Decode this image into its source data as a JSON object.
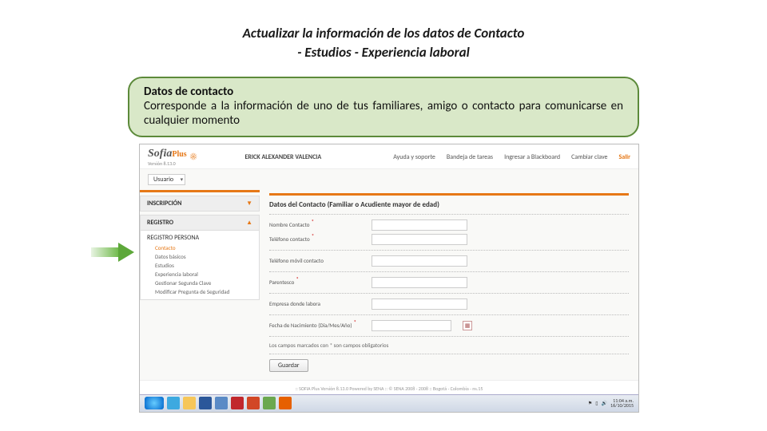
{
  "slide": {
    "title_line1": "Actualizar la información de los datos de Contacto",
    "title_line2": "- Estudios - Experiencia laboral"
  },
  "infobox": {
    "heading": "Datos de contacto",
    "body": "Corresponde a la información de uno de tus familiares, amigo o contacto para comunicarse en cualquier momento"
  },
  "logo": {
    "brand": "Sofia",
    "suffix": "Plus",
    "version": "Versión 8.13.0"
  },
  "topbar": {
    "user": "ERICK ALEXANDER VALENCIA",
    "links": {
      "help": "Ayuda y soporte",
      "tasks": "Bandeja de tareas",
      "blackboard": "Ingresar a Blackboard",
      "password": "Cambiar clave",
      "exit": "Salir"
    }
  },
  "role_select": "Usuario",
  "sidebar": {
    "inscripcion": "INSCRIPCIÓN",
    "registro": "REGISTRO",
    "group_title": "REGISTRO PERSONA",
    "items": {
      "contacto": "Contacto",
      "datos_basicos": "Datos básicos",
      "estudios": "Estudios",
      "experiencia": "Experiencia laboral",
      "segunda_clave": "Gestionar Segunda Clave",
      "pregunta": "Modificar Pregunta de Seguridad"
    }
  },
  "form": {
    "section_title": "Datos del Contacto (Familiar o Acudiente mayor de edad)",
    "labels": {
      "nombre": "Nombre Contacto",
      "telefono": "Teléfono contacto",
      "movil": "Teléfono móvil contacto",
      "parentesco": "Parentesco",
      "empresa": "Empresa donde labora",
      "fecha": "Fecha de Nacimiento (Día/Mes/Año)"
    },
    "note": "Los campos marcados con * son campos obligatorios",
    "save": "Guardar"
  },
  "footer": ":: SOFIA Plus Versión 8.13.0  Powered by SENA :: © SENA 2008 - 2008 :: Bogotá - Colombia - ns.15",
  "taskbar": {
    "time": "11:04 a.m.",
    "date": "16/10/2015"
  }
}
